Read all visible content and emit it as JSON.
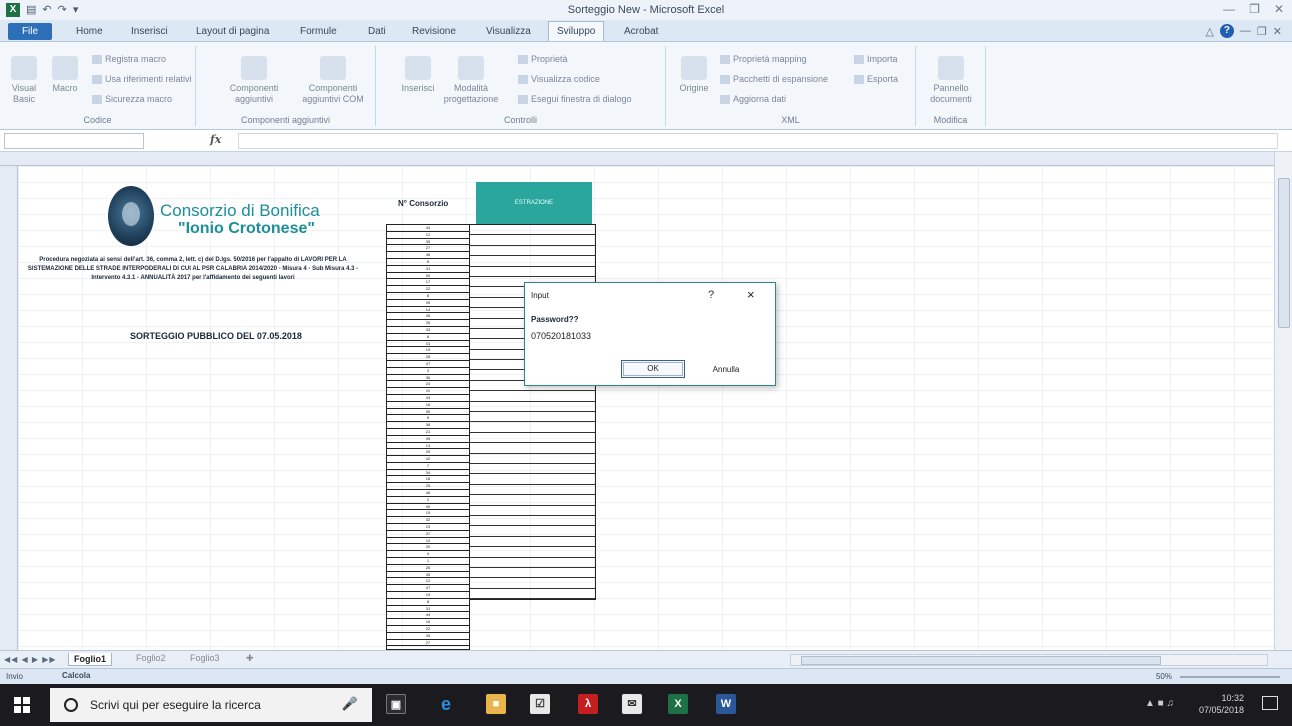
{
  "window": {
    "title": "Sorteggio New - Microsoft Excel"
  },
  "ribbon": {
    "file_tab": "File",
    "tabs": [
      "Home",
      "Inserisci",
      "Layout di pagina",
      "Formule",
      "Dati",
      "Revisione",
      "Visualizza",
      "Sviluppo",
      "Acrobat"
    ],
    "active_tab": "Sviluppo",
    "groups": {
      "codice": {
        "name": "Codice",
        "visual_basic": "Visual Basic",
        "macro": "Macro",
        "registra_macro": "Registra macro",
        "riferimenti_relativi": "Usa riferimenti relativi",
        "sicurezza_macro": "Sicurezza macro"
      },
      "componenti": {
        "name": "Componenti aggiuntivi",
        "componenti_aggiuntivi": "Componenti aggiuntivi",
        "componenti_com": "Componenti aggiuntivi COM"
      },
      "controlli": {
        "name": "Controlli",
        "inserisci": "Inserisci",
        "modalita": "Modalità progettazione",
        "proprieta": "Proprietà",
        "visualizza_codice": "Visualizza codice",
        "esegui_finestra": "Esegui finestra di dialogo"
      },
      "xml": {
        "name": "XML",
        "origine": "Origine",
        "proprieta_mapping": "Proprietà mapping",
        "pacchetti_espansione": "Pacchetti di espansione",
        "aggiorna_dati": "Aggiorna dati",
        "importa": "Importa",
        "esporta": "Esporta"
      },
      "modifica": {
        "name": "Modifica",
        "pannello_documenti": "Pannello documenti"
      }
    }
  },
  "formula_bar": {
    "fx": "fx"
  },
  "sheet": {
    "org_name": "Consorzio di Bonifica",
    "org_subname": "\"Ionio Crotonese\"",
    "description": "Procedura negoziata ai sensi dell'art. 36, comma 2, lett. c) del D.lgs. 50/2016 per l'appalto di LAVORI PER LA SISTEMAZIONE DELLE STRADE INTERPODERALI DI CUI AL PSR CALABRIA 2014/2020 - Misura 4 - Sub Misura 4.3 - Intervento 4.3.1 - ANNUALITÀ 2017 per l'affidamento dei seguenti lavori",
    "draw_title": "SORTEGGIO PUBBLICO DEL 07.05.2018",
    "col_label": "N° Consorzio",
    "header_cell": "ESTRAZIONE",
    "numbers": [
      "44",
      "12",
      "35",
      "27",
      "48",
      "9",
      "31",
      "50",
      "17",
      "22",
      "8",
      "39",
      "14",
      "45",
      "26",
      "33",
      "6",
      "41",
      "19",
      "28",
      "47",
      "3",
      "36",
      "24",
      "11",
      "43",
      "16",
      "30",
      "5",
      "38",
      "21",
      "49",
      "13",
      "29",
      "42",
      "7",
      "34",
      "18",
      "25",
      "46",
      "2",
      "40",
      "15",
      "32",
      "23",
      "37",
      "10",
      "20",
      "4",
      "1",
      "26",
      "35",
      "12",
      "47",
      "19",
      "8",
      "31",
      "44",
      "16",
      "22",
      "39",
      "27"
    ]
  },
  "dialog": {
    "title": "Input",
    "help": "?",
    "close": "×",
    "prompt": "Password??",
    "value": "070520181033",
    "ok": "OK",
    "cancel": "Annulla"
  },
  "sheet_tabs": {
    "items": [
      "Foglio1",
      "Foglio2",
      "Foglio3"
    ],
    "active": "Foglio1"
  },
  "status_bar": {
    "mode": "Invio",
    "calc": "Calcola",
    "zoom": "50%"
  },
  "taskbar": {
    "search_placeholder": "Scrivi qui per eseguire la ricerca",
    "time": "10:32",
    "date": "07/05/2018"
  }
}
